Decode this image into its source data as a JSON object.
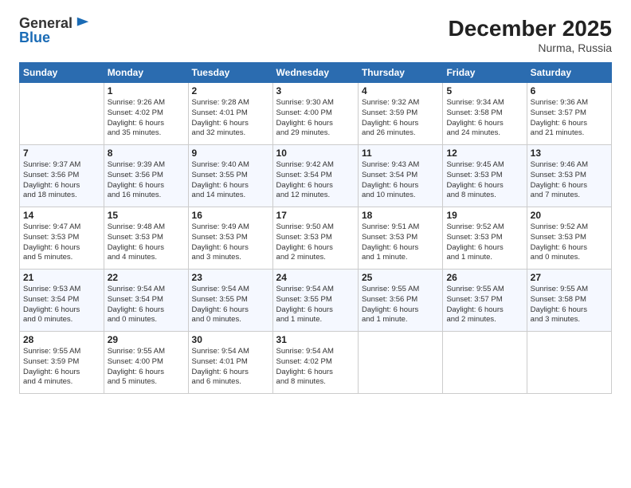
{
  "logo": {
    "general": "General",
    "blue": "Blue"
  },
  "header": {
    "month": "December 2025",
    "location": "Nurma, Russia"
  },
  "weekdays": [
    "Sunday",
    "Monday",
    "Tuesday",
    "Wednesday",
    "Thursday",
    "Friday",
    "Saturday"
  ],
  "weeks": [
    [
      {
        "day": "",
        "info": ""
      },
      {
        "day": "1",
        "info": "Sunrise: 9:26 AM\nSunset: 4:02 PM\nDaylight: 6 hours\nand 35 minutes."
      },
      {
        "day": "2",
        "info": "Sunrise: 9:28 AM\nSunset: 4:01 PM\nDaylight: 6 hours\nand 32 minutes."
      },
      {
        "day": "3",
        "info": "Sunrise: 9:30 AM\nSunset: 4:00 PM\nDaylight: 6 hours\nand 29 minutes."
      },
      {
        "day": "4",
        "info": "Sunrise: 9:32 AM\nSunset: 3:59 PM\nDaylight: 6 hours\nand 26 minutes."
      },
      {
        "day": "5",
        "info": "Sunrise: 9:34 AM\nSunset: 3:58 PM\nDaylight: 6 hours\nand 24 minutes."
      },
      {
        "day": "6",
        "info": "Sunrise: 9:36 AM\nSunset: 3:57 PM\nDaylight: 6 hours\nand 21 minutes."
      }
    ],
    [
      {
        "day": "7",
        "info": "Sunrise: 9:37 AM\nSunset: 3:56 PM\nDaylight: 6 hours\nand 18 minutes."
      },
      {
        "day": "8",
        "info": "Sunrise: 9:39 AM\nSunset: 3:56 PM\nDaylight: 6 hours\nand 16 minutes."
      },
      {
        "day": "9",
        "info": "Sunrise: 9:40 AM\nSunset: 3:55 PM\nDaylight: 6 hours\nand 14 minutes."
      },
      {
        "day": "10",
        "info": "Sunrise: 9:42 AM\nSunset: 3:54 PM\nDaylight: 6 hours\nand 12 minutes."
      },
      {
        "day": "11",
        "info": "Sunrise: 9:43 AM\nSunset: 3:54 PM\nDaylight: 6 hours\nand 10 minutes."
      },
      {
        "day": "12",
        "info": "Sunrise: 9:45 AM\nSunset: 3:53 PM\nDaylight: 6 hours\nand 8 minutes."
      },
      {
        "day": "13",
        "info": "Sunrise: 9:46 AM\nSunset: 3:53 PM\nDaylight: 6 hours\nand 7 minutes."
      }
    ],
    [
      {
        "day": "14",
        "info": "Sunrise: 9:47 AM\nSunset: 3:53 PM\nDaylight: 6 hours\nand 5 minutes."
      },
      {
        "day": "15",
        "info": "Sunrise: 9:48 AM\nSunset: 3:53 PM\nDaylight: 6 hours\nand 4 minutes."
      },
      {
        "day": "16",
        "info": "Sunrise: 9:49 AM\nSunset: 3:53 PM\nDaylight: 6 hours\nand 3 minutes."
      },
      {
        "day": "17",
        "info": "Sunrise: 9:50 AM\nSunset: 3:53 PM\nDaylight: 6 hours\nand 2 minutes."
      },
      {
        "day": "18",
        "info": "Sunrise: 9:51 AM\nSunset: 3:53 PM\nDaylight: 6 hours\nand 1 minute."
      },
      {
        "day": "19",
        "info": "Sunrise: 9:52 AM\nSunset: 3:53 PM\nDaylight: 6 hours\nand 1 minute."
      },
      {
        "day": "20",
        "info": "Sunrise: 9:52 AM\nSunset: 3:53 PM\nDaylight: 6 hours\nand 0 minutes."
      }
    ],
    [
      {
        "day": "21",
        "info": "Sunrise: 9:53 AM\nSunset: 3:54 PM\nDaylight: 6 hours\nand 0 minutes."
      },
      {
        "day": "22",
        "info": "Sunrise: 9:54 AM\nSunset: 3:54 PM\nDaylight: 6 hours\nand 0 minutes."
      },
      {
        "day": "23",
        "info": "Sunrise: 9:54 AM\nSunset: 3:55 PM\nDaylight: 6 hours\nand 0 minutes."
      },
      {
        "day": "24",
        "info": "Sunrise: 9:54 AM\nSunset: 3:55 PM\nDaylight: 6 hours\nand 1 minute."
      },
      {
        "day": "25",
        "info": "Sunrise: 9:55 AM\nSunset: 3:56 PM\nDaylight: 6 hours\nand 1 minute."
      },
      {
        "day": "26",
        "info": "Sunrise: 9:55 AM\nSunset: 3:57 PM\nDaylight: 6 hours\nand 2 minutes."
      },
      {
        "day": "27",
        "info": "Sunrise: 9:55 AM\nSunset: 3:58 PM\nDaylight: 6 hours\nand 3 minutes."
      }
    ],
    [
      {
        "day": "28",
        "info": "Sunrise: 9:55 AM\nSunset: 3:59 PM\nDaylight: 6 hours\nand 4 minutes."
      },
      {
        "day": "29",
        "info": "Sunrise: 9:55 AM\nSunset: 4:00 PM\nDaylight: 6 hours\nand 5 minutes."
      },
      {
        "day": "30",
        "info": "Sunrise: 9:54 AM\nSunset: 4:01 PM\nDaylight: 6 hours\nand 6 minutes."
      },
      {
        "day": "31",
        "info": "Sunrise: 9:54 AM\nSunset: 4:02 PM\nDaylight: 6 hours\nand 8 minutes."
      },
      {
        "day": "",
        "info": ""
      },
      {
        "day": "",
        "info": ""
      },
      {
        "day": "",
        "info": ""
      }
    ]
  ]
}
